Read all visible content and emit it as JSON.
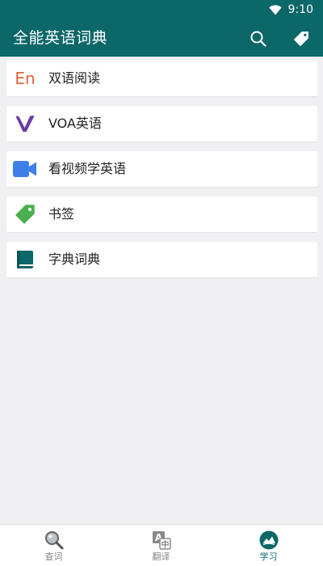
{
  "status_bar": {
    "time": "9:10"
  },
  "app_bar": {
    "title": "全能英语词典",
    "color": "#0b6768"
  },
  "menu": {
    "items": [
      {
        "label": "双语阅读",
        "icon": "en-text-icon",
        "icon_text": "En",
        "color": "#e0653a"
      },
      {
        "label": "VOA英语",
        "icon": "voa-logo-icon",
        "color": "#6a3aa8"
      },
      {
        "label": "看视频学英语",
        "icon": "video-camera-icon",
        "color": "#3f7fe8"
      },
      {
        "label": "书签",
        "icon": "bookmark-tag-icon",
        "color": "#4caf50"
      },
      {
        "label": "字典词典",
        "icon": "dictionary-book-icon",
        "color": "#0b6768"
      }
    ]
  },
  "bottom_nav": {
    "items": [
      {
        "label": "查词",
        "icon": "magnifier-icon",
        "active": false
      },
      {
        "label": "翻译",
        "icon": "translate-icon",
        "active": false
      },
      {
        "label": "学习",
        "icon": "learn-icon",
        "active": true
      }
    ],
    "active_color": "#0b6768"
  }
}
